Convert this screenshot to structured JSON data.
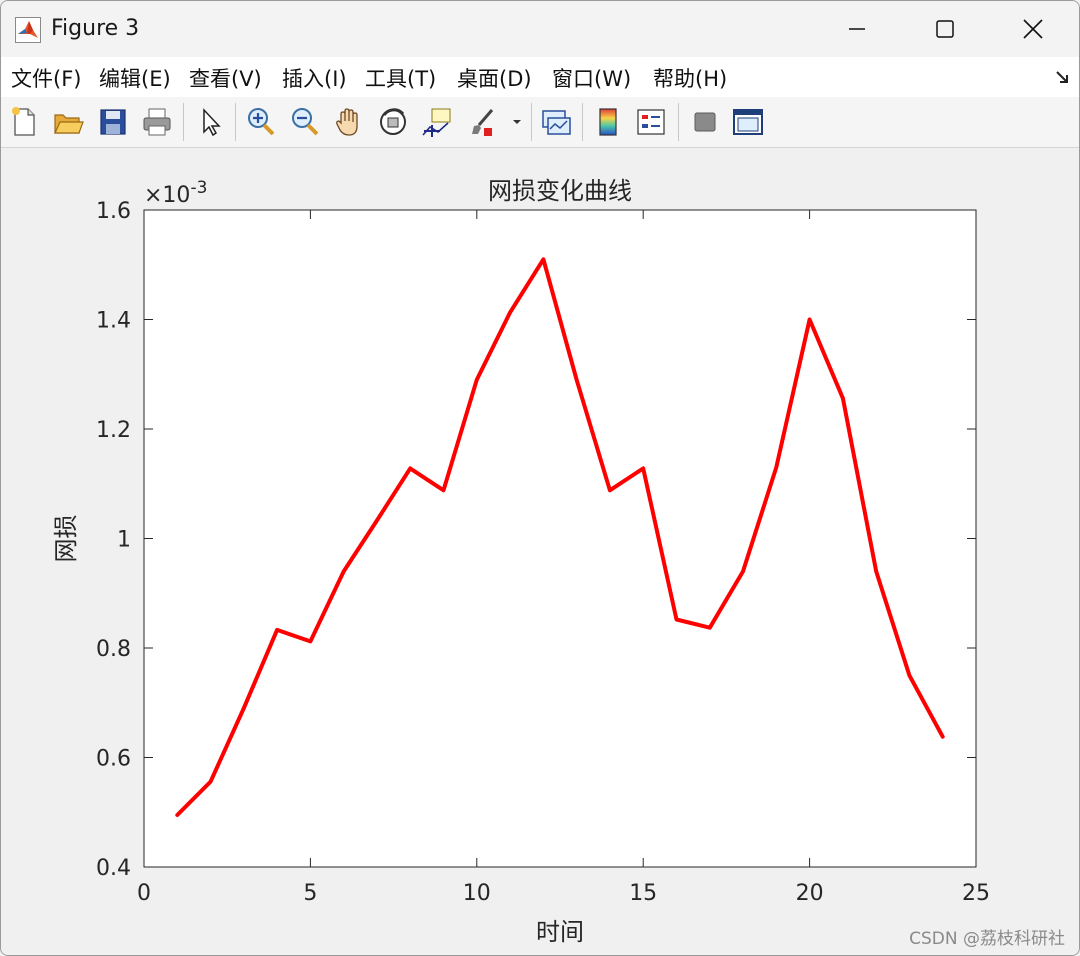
{
  "window": {
    "title": "Figure 3",
    "controls": {
      "minimize": "minimize",
      "maximize": "maximize",
      "close": "close"
    }
  },
  "menu": {
    "items": [
      {
        "label": "文件(F)"
      },
      {
        "label": "编辑(E)"
      },
      {
        "label": "查看(V)"
      },
      {
        "label": "插入(I)"
      },
      {
        "label": "工具(T)"
      },
      {
        "label": "桌面(D)"
      },
      {
        "label": "窗口(W)"
      },
      {
        "label": "帮助(H)"
      }
    ]
  },
  "toolbar": {
    "icons": [
      "new-file-icon",
      "open-folder-icon",
      "save-icon",
      "print-icon",
      "select-pointer-icon",
      "zoom-in-icon",
      "zoom-out-icon",
      "pan-hand-icon",
      "rotate-3d-icon",
      "data-cursor-icon",
      "brush-icon",
      "link-plot-icon",
      "colorbar-icon",
      "legend-icon",
      "hide-plot-tools-icon",
      "show-plot-tools-icon"
    ]
  },
  "chart_data": {
    "type": "line",
    "title": "网损变化曲线",
    "xlabel": "时间",
    "ylabel": "网损",
    "exponent_label": "×10",
    "exponent_power": "-3",
    "xlim": [
      0,
      25
    ],
    "ylim": [
      0.4,
      1.6
    ],
    "xticks": [
      "0",
      "5",
      "10",
      "15",
      "20",
      "25"
    ],
    "yticks": [
      "0.4",
      "0.6",
      "0.8",
      "1",
      "1.2",
      "1.4",
      "1.6"
    ],
    "grid": false,
    "line_color": "#ff0000",
    "series": [
      {
        "x": [
          1,
          2,
          3,
          4,
          5,
          6,
          7,
          8,
          9,
          10,
          11,
          12,
          13,
          14,
          15,
          16,
          17,
          18,
          19,
          20,
          21,
          22,
          23,
          24
        ],
        "y": [
          0.495,
          0.556,
          0.69,
          0.833,
          0.812,
          0.94,
          1.033,
          1.128,
          1.088,
          1.29,
          1.413,
          1.51,
          1.29,
          1.088,
          1.128,
          0.852,
          0.837,
          0.94,
          1.13,
          1.4,
          1.256,
          0.94,
          0.75,
          0.638
        ]
      }
    ]
  },
  "watermark": "CSDN @荔枝科研社"
}
